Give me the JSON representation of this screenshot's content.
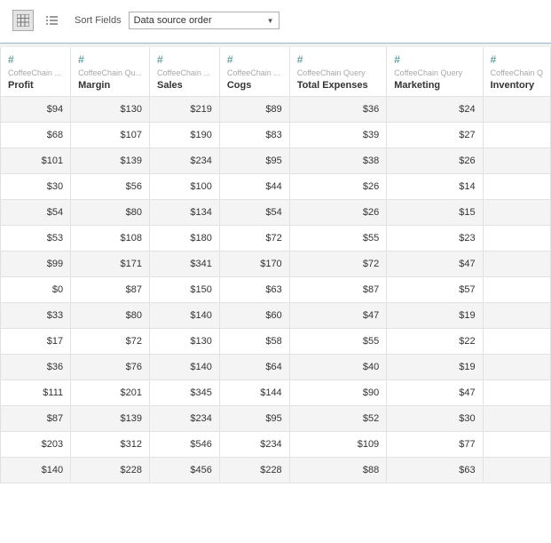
{
  "toolbar": {
    "sort_label": "Sort Fields",
    "dropdown_value": "Data source order"
  },
  "columns": [
    {
      "source": "CoffeeChain ...",
      "name": "Profit"
    },
    {
      "source": "CoffeeChain Qu...",
      "name": "Margin"
    },
    {
      "source": "CoffeeChain ...",
      "name": "Sales"
    },
    {
      "source": "CoffeeChain ...",
      "name": "Cogs"
    },
    {
      "source": "CoffeeChain Query",
      "name": "Total Expenses"
    },
    {
      "source": "CoffeeChain Query",
      "name": "Marketing"
    },
    {
      "source": "CoffeeChain Q",
      "name": "Inventory"
    }
  ],
  "rows": [
    [
      "$94",
      "$130",
      "$219",
      "$89",
      "$36",
      "$24",
      ""
    ],
    [
      "$68",
      "$107",
      "$190",
      "$83",
      "$39",
      "$27",
      ""
    ],
    [
      "$101",
      "$139",
      "$234",
      "$95",
      "$38",
      "$26",
      ""
    ],
    [
      "$30",
      "$56",
      "$100",
      "$44",
      "$26",
      "$14",
      ""
    ],
    [
      "$54",
      "$80",
      "$134",
      "$54",
      "$26",
      "$15",
      ""
    ],
    [
      "$53",
      "$108",
      "$180",
      "$72",
      "$55",
      "$23",
      ""
    ],
    [
      "$99",
      "$171",
      "$341",
      "$170",
      "$72",
      "$47",
      ""
    ],
    [
      "$0",
      "$87",
      "$150",
      "$63",
      "$87",
      "$57",
      ""
    ],
    [
      "$33",
      "$80",
      "$140",
      "$60",
      "$47",
      "$19",
      ""
    ],
    [
      "$17",
      "$72",
      "$130",
      "$58",
      "$55",
      "$22",
      ""
    ],
    [
      "$36",
      "$76",
      "$140",
      "$64",
      "$40",
      "$19",
      ""
    ],
    [
      "$111",
      "$201",
      "$345",
      "$144",
      "$90",
      "$47",
      ""
    ],
    [
      "$87",
      "$139",
      "$234",
      "$95",
      "$52",
      "$30",
      ""
    ],
    [
      "$203",
      "$312",
      "$546",
      "$234",
      "$109",
      "$77",
      ""
    ],
    [
      "$140",
      "$228",
      "$456",
      "$228",
      "$88",
      "$63",
      ""
    ]
  ],
  "chart_data": {
    "type": "table",
    "columns": [
      "Profit",
      "Margin",
      "Sales",
      "Cogs",
      "Total Expenses",
      "Marketing"
    ],
    "data": [
      [
        94,
        130,
        219,
        89,
        36,
        24
      ],
      [
        68,
        107,
        190,
        83,
        39,
        27
      ],
      [
        101,
        139,
        234,
        95,
        38,
        26
      ],
      [
        30,
        56,
        100,
        44,
        26,
        14
      ],
      [
        54,
        80,
        134,
        54,
        26,
        15
      ],
      [
        53,
        108,
        180,
        72,
        55,
        23
      ],
      [
        99,
        171,
        341,
        170,
        72,
        47
      ],
      [
        0,
        87,
        150,
        63,
        87,
        57
      ],
      [
        33,
        80,
        140,
        60,
        47,
        19
      ],
      [
        17,
        72,
        130,
        58,
        55,
        22
      ],
      [
        36,
        76,
        140,
        64,
        40,
        19
      ],
      [
        111,
        201,
        345,
        144,
        90,
        47
      ],
      [
        87,
        139,
        234,
        95,
        52,
        30
      ],
      [
        203,
        312,
        546,
        234,
        109,
        77
      ],
      [
        140,
        228,
        456,
        228,
        88,
        63
      ]
    ],
    "currency": "USD"
  }
}
